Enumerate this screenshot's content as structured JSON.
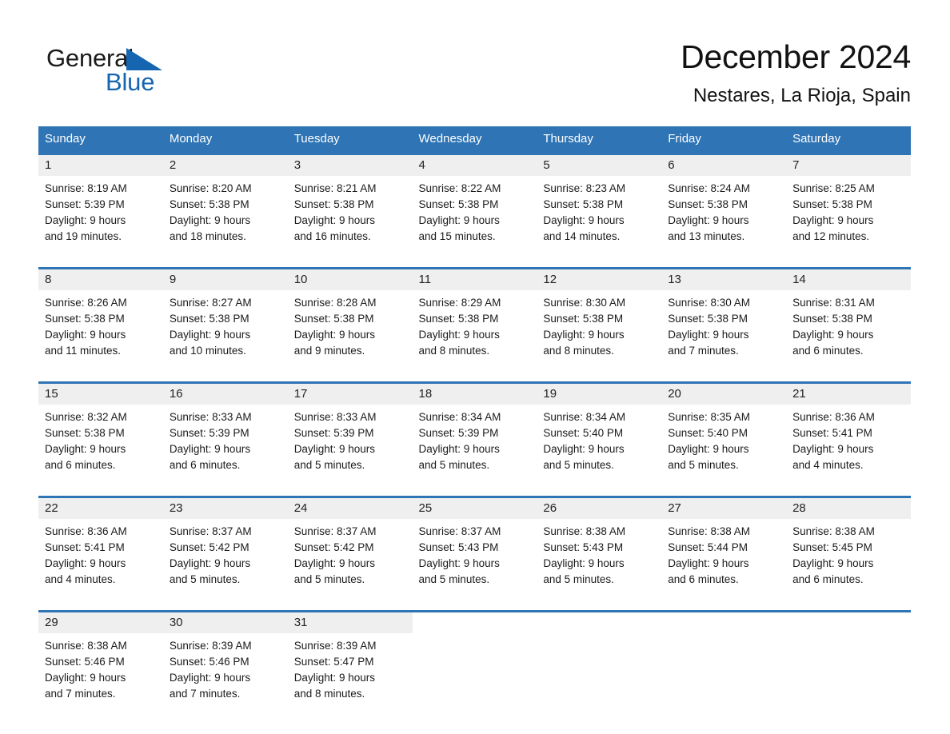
{
  "brand": {
    "name_part1": "General",
    "name_part2": "Blue",
    "logo_icon": "blue-triangle-flag-icon",
    "accent_color": "#1565b0"
  },
  "header": {
    "title": "December 2024",
    "location": "Nestares, La Rioja, Spain"
  },
  "theme": {
    "header_blue": "#2f74b5",
    "daynum_band": "#efefef",
    "text_color": "#1b1b1b"
  },
  "weekday_headers": [
    "Sunday",
    "Monday",
    "Tuesday",
    "Wednesday",
    "Thursday",
    "Friday",
    "Saturday"
  ],
  "weeks": [
    [
      {
        "day": "1",
        "sunrise": "Sunrise: 8:19 AM",
        "sunset": "Sunset: 5:39 PM",
        "daylight_line1": "Daylight: 9 hours",
        "daylight_line2": "and 19 minutes."
      },
      {
        "day": "2",
        "sunrise": "Sunrise: 8:20 AM",
        "sunset": "Sunset: 5:38 PM",
        "daylight_line1": "Daylight: 9 hours",
        "daylight_line2": "and 18 minutes."
      },
      {
        "day": "3",
        "sunrise": "Sunrise: 8:21 AM",
        "sunset": "Sunset: 5:38 PM",
        "daylight_line1": "Daylight: 9 hours",
        "daylight_line2": "and 16 minutes."
      },
      {
        "day": "4",
        "sunrise": "Sunrise: 8:22 AM",
        "sunset": "Sunset: 5:38 PM",
        "daylight_line1": "Daylight: 9 hours",
        "daylight_line2": "and 15 minutes."
      },
      {
        "day": "5",
        "sunrise": "Sunrise: 8:23 AM",
        "sunset": "Sunset: 5:38 PM",
        "daylight_line1": "Daylight: 9 hours",
        "daylight_line2": "and 14 minutes."
      },
      {
        "day": "6",
        "sunrise": "Sunrise: 8:24 AM",
        "sunset": "Sunset: 5:38 PM",
        "daylight_line1": "Daylight: 9 hours",
        "daylight_line2": "and 13 minutes."
      },
      {
        "day": "7",
        "sunrise": "Sunrise: 8:25 AM",
        "sunset": "Sunset: 5:38 PM",
        "daylight_line1": "Daylight: 9 hours",
        "daylight_line2": "and 12 minutes."
      }
    ],
    [
      {
        "day": "8",
        "sunrise": "Sunrise: 8:26 AM",
        "sunset": "Sunset: 5:38 PM",
        "daylight_line1": "Daylight: 9 hours",
        "daylight_line2": "and 11 minutes."
      },
      {
        "day": "9",
        "sunrise": "Sunrise: 8:27 AM",
        "sunset": "Sunset: 5:38 PM",
        "daylight_line1": "Daylight: 9 hours",
        "daylight_line2": "and 10 minutes."
      },
      {
        "day": "10",
        "sunrise": "Sunrise: 8:28 AM",
        "sunset": "Sunset: 5:38 PM",
        "daylight_line1": "Daylight: 9 hours",
        "daylight_line2": "and 9 minutes."
      },
      {
        "day": "11",
        "sunrise": "Sunrise: 8:29 AM",
        "sunset": "Sunset: 5:38 PM",
        "daylight_line1": "Daylight: 9 hours",
        "daylight_line2": "and 8 minutes."
      },
      {
        "day": "12",
        "sunrise": "Sunrise: 8:30 AM",
        "sunset": "Sunset: 5:38 PM",
        "daylight_line1": "Daylight: 9 hours",
        "daylight_line2": "and 8 minutes."
      },
      {
        "day": "13",
        "sunrise": "Sunrise: 8:30 AM",
        "sunset": "Sunset: 5:38 PM",
        "daylight_line1": "Daylight: 9 hours",
        "daylight_line2": "and 7 minutes."
      },
      {
        "day": "14",
        "sunrise": "Sunrise: 8:31 AM",
        "sunset": "Sunset: 5:38 PM",
        "daylight_line1": "Daylight: 9 hours",
        "daylight_line2": "and 6 minutes."
      }
    ],
    [
      {
        "day": "15",
        "sunrise": "Sunrise: 8:32 AM",
        "sunset": "Sunset: 5:38 PM",
        "daylight_line1": "Daylight: 9 hours",
        "daylight_line2": "and 6 minutes."
      },
      {
        "day": "16",
        "sunrise": "Sunrise: 8:33 AM",
        "sunset": "Sunset: 5:39 PM",
        "daylight_line1": "Daylight: 9 hours",
        "daylight_line2": "and 6 minutes."
      },
      {
        "day": "17",
        "sunrise": "Sunrise: 8:33 AM",
        "sunset": "Sunset: 5:39 PM",
        "daylight_line1": "Daylight: 9 hours",
        "daylight_line2": "and 5 minutes."
      },
      {
        "day": "18",
        "sunrise": "Sunrise: 8:34 AM",
        "sunset": "Sunset: 5:39 PM",
        "daylight_line1": "Daylight: 9 hours",
        "daylight_line2": "and 5 minutes."
      },
      {
        "day": "19",
        "sunrise": "Sunrise: 8:34 AM",
        "sunset": "Sunset: 5:40 PM",
        "daylight_line1": "Daylight: 9 hours",
        "daylight_line2": "and 5 minutes."
      },
      {
        "day": "20",
        "sunrise": "Sunrise: 8:35 AM",
        "sunset": "Sunset: 5:40 PM",
        "daylight_line1": "Daylight: 9 hours",
        "daylight_line2": "and 5 minutes."
      },
      {
        "day": "21",
        "sunrise": "Sunrise: 8:36 AM",
        "sunset": "Sunset: 5:41 PM",
        "daylight_line1": "Daylight: 9 hours",
        "daylight_line2": "and 4 minutes."
      }
    ],
    [
      {
        "day": "22",
        "sunrise": "Sunrise: 8:36 AM",
        "sunset": "Sunset: 5:41 PM",
        "daylight_line1": "Daylight: 9 hours",
        "daylight_line2": "and 4 minutes."
      },
      {
        "day": "23",
        "sunrise": "Sunrise: 8:37 AM",
        "sunset": "Sunset: 5:42 PM",
        "daylight_line1": "Daylight: 9 hours",
        "daylight_line2": "and 5 minutes."
      },
      {
        "day": "24",
        "sunrise": "Sunrise: 8:37 AM",
        "sunset": "Sunset: 5:42 PM",
        "daylight_line1": "Daylight: 9 hours",
        "daylight_line2": "and 5 minutes."
      },
      {
        "day": "25",
        "sunrise": "Sunrise: 8:37 AM",
        "sunset": "Sunset: 5:43 PM",
        "daylight_line1": "Daylight: 9 hours",
        "daylight_line2": "and 5 minutes."
      },
      {
        "day": "26",
        "sunrise": "Sunrise: 8:38 AM",
        "sunset": "Sunset: 5:43 PM",
        "daylight_line1": "Daylight: 9 hours",
        "daylight_line2": "and 5 minutes."
      },
      {
        "day": "27",
        "sunrise": "Sunrise: 8:38 AM",
        "sunset": "Sunset: 5:44 PM",
        "daylight_line1": "Daylight: 9 hours",
        "daylight_line2": "and 6 minutes."
      },
      {
        "day": "28",
        "sunrise": "Sunrise: 8:38 AM",
        "sunset": "Sunset: 5:45 PM",
        "daylight_line1": "Daylight: 9 hours",
        "daylight_line2": "and 6 minutes."
      }
    ],
    [
      {
        "day": "29",
        "sunrise": "Sunrise: 8:38 AM",
        "sunset": "Sunset: 5:46 PM",
        "daylight_line1": "Daylight: 9 hours",
        "daylight_line2": "and 7 minutes."
      },
      {
        "day": "30",
        "sunrise": "Sunrise: 8:39 AM",
        "sunset": "Sunset: 5:46 PM",
        "daylight_line1": "Daylight: 9 hours",
        "daylight_line2": "and 7 minutes."
      },
      {
        "day": "31",
        "sunrise": "Sunrise: 8:39 AM",
        "sunset": "Sunset: 5:47 PM",
        "daylight_line1": "Daylight: 9 hours",
        "daylight_line2": "and 8 minutes."
      },
      {
        "day": "",
        "sunrise": "",
        "sunset": "",
        "daylight_line1": "",
        "daylight_line2": ""
      },
      {
        "day": "",
        "sunrise": "",
        "sunset": "",
        "daylight_line1": "",
        "daylight_line2": ""
      },
      {
        "day": "",
        "sunrise": "",
        "sunset": "",
        "daylight_line1": "",
        "daylight_line2": ""
      },
      {
        "day": "",
        "sunrise": "",
        "sunset": "",
        "daylight_line1": "",
        "daylight_line2": ""
      }
    ]
  ]
}
